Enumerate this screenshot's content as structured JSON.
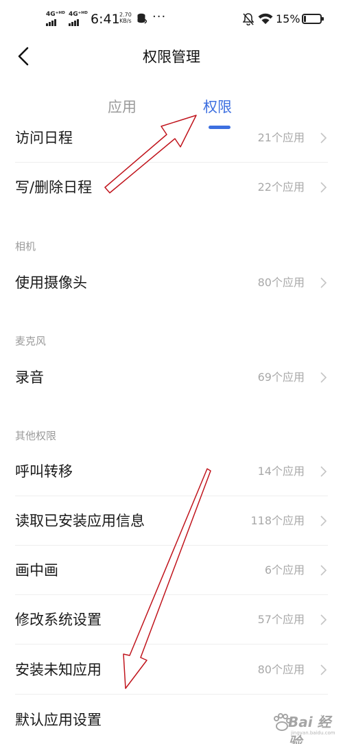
{
  "status_bar": {
    "net1": "4G⁺ᴴᴰ",
    "net2": "4G⁺ᴴᴰ",
    "time": "6:41",
    "speed_value": "2.70",
    "speed_unit": "KB/s",
    "more": "···",
    "battery": "15%",
    "battery_level": 0.15,
    "icons": [
      "signal-icon",
      "data-icon",
      "mute-icon",
      "wifi-icon",
      "battery-icon"
    ]
  },
  "header": {
    "title": "权限管理",
    "back_icon": "back-arrow-icon"
  },
  "tabs": [
    {
      "label": "应用",
      "active": false
    },
    {
      "label": "权限",
      "active": true
    }
  ],
  "accent_color": "#3d6fe0",
  "rows": [
    {
      "label": "访问日程",
      "count": "21个应用"
    },
    {
      "label": "写/删除日程",
      "count": "22个应用"
    },
    {
      "label": "使用摄像头",
      "count": "80个应用"
    },
    {
      "label": "录音",
      "count": "69个应用"
    },
    {
      "label": "呼叫转移",
      "count": "14个应用"
    },
    {
      "label": "读取已安装应用信息",
      "count": "118个应用"
    },
    {
      "label": "画中画",
      "count": "6个应用"
    },
    {
      "label": "修改系统设置",
      "count": "57个应用"
    },
    {
      "label": "安装未知应用",
      "count": "80个应用"
    },
    {
      "label": "默认应用设置",
      "count": ""
    }
  ],
  "sections": [
    "相机",
    "麦克风",
    "其他权限"
  ],
  "annotation_color": "#c0141c",
  "watermark": {
    "text": "Bai 经验",
    "sub": "jingyan.baidu.com"
  }
}
